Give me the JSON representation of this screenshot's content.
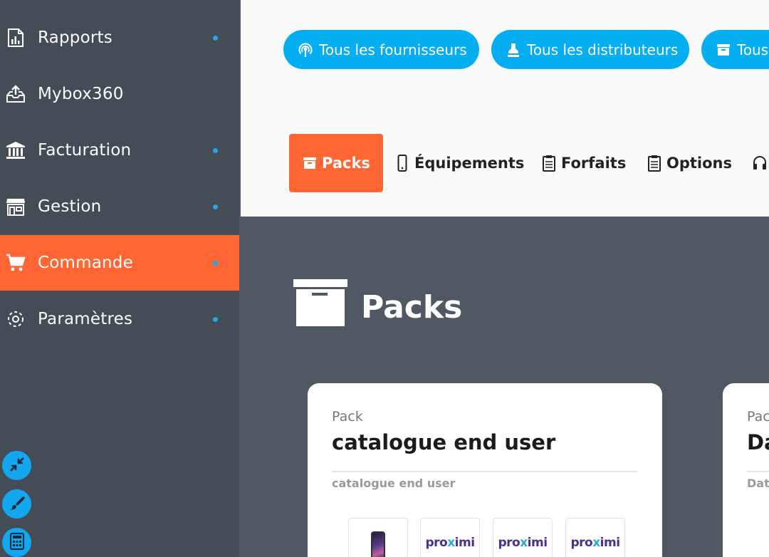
{
  "sidebar": {
    "items": [
      {
        "label": "Rapports",
        "icon": "report-chart-icon",
        "has_dot": true,
        "active": false
      },
      {
        "label": "Mybox360",
        "icon": "upload-tray-icon",
        "has_dot": false,
        "active": false
      },
      {
        "label": "Facturation",
        "icon": "bank-icon",
        "has_dot": true,
        "active": false
      },
      {
        "label": "Gestion",
        "icon": "store-icon",
        "has_dot": true,
        "active": false
      },
      {
        "label": "Commande",
        "icon": "cart-icon",
        "has_dot": true,
        "active": true
      },
      {
        "label": "Paramètres",
        "icon": "gear-icon",
        "has_dot": true,
        "active": false
      }
    ],
    "tools": [
      "collapse-arrows-icon",
      "paintbrush-icon",
      "calculator-icon"
    ]
  },
  "filters": {
    "pills": [
      {
        "label": "Tous les fournisseurs",
        "icon": "broadcast-icon"
      },
      {
        "label": "Tous les distributeurs",
        "icon": "stamp-icon"
      },
      {
        "label": "Tous",
        "icon": "box-icon"
      }
    ]
  },
  "tabs": [
    {
      "label": "Packs",
      "icon": "box-icon",
      "active": true
    },
    {
      "label": "Équipements",
      "icon": "mobile-icon",
      "active": false
    },
    {
      "label": "Forfaits",
      "icon": "clipboard-icon",
      "active": false
    },
    {
      "label": "Options",
      "icon": "clipboard-icon",
      "active": false
    },
    {
      "label": "",
      "icon": "headset-icon",
      "active": false
    }
  ],
  "section": {
    "title": "Packs",
    "icon": "box-icon"
  },
  "cards": [
    {
      "kicker": "Pack",
      "title": "catalogue end user",
      "subtitle": "catalogue end user",
      "thumbnails": [
        {
          "kind": "phone",
          "text": ""
        },
        {
          "kind": "logo",
          "text_a": "pro",
          "text_x": "x",
          "text_b": "imi"
        },
        {
          "kind": "logo",
          "text_a": "pro",
          "text_x": "x",
          "text_b": "imi"
        },
        {
          "kind": "logo",
          "text_a": "pro",
          "text_x": "x",
          "text_b": "imi"
        }
      ]
    },
    {
      "kicker": "Pac",
      "title": "Da",
      "subtitle": "Dat"
    }
  ],
  "colors": {
    "accent": "#ff6633",
    "primary_blue": "#05aef0",
    "sidebar_bg": "#444c56",
    "main_bg": "#4f5863"
  }
}
